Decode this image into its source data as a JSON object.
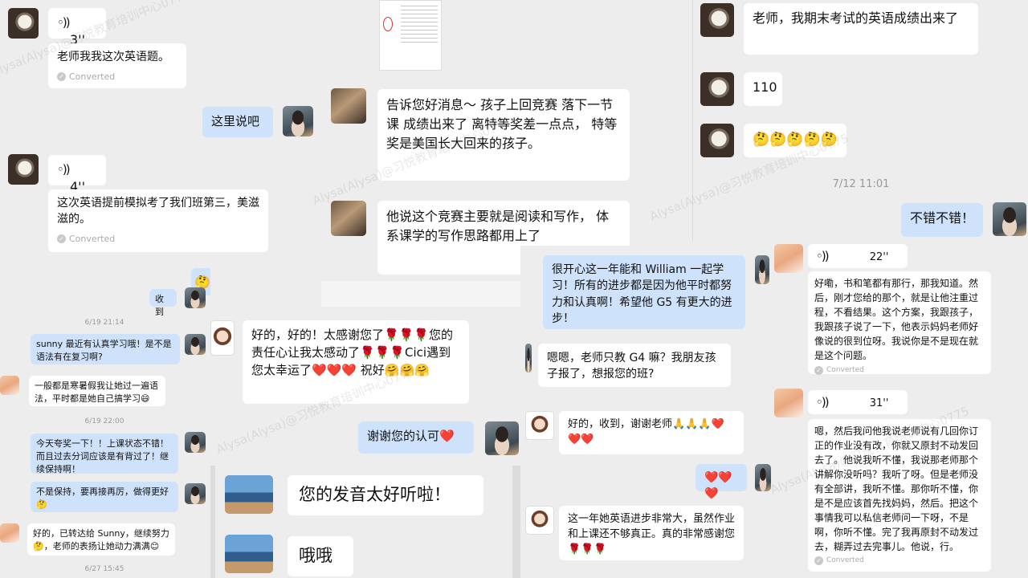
{
  "panel_left_top": {
    "voice1_duration": "3''",
    "msg1": "老师我我这次英语题。",
    "converted": "Converted",
    "reply1": "这里说吧",
    "voice2_duration": "4''",
    "msg2": "这次英语提前模拟考了我们班第三，美滋滋的。"
  },
  "panel_center_top": {
    "msg1": "告诉您好消息～ 孩子上回竞赛 落下一节课 成绩出来了 离特等奖差一点点， 特等奖是美国长大回来的孩子。",
    "msg2": "他说这个竞赛主要就是阅读和写作， 体系课学的写作思路都用上了"
  },
  "panel_right_top": {
    "msg1": "老师，我期末考试的英语成绩出来了",
    "msg2": "110",
    "msg3": "🤔🤔🤔🤔🤔",
    "time1": "7/12 11:01",
    "reply1": "不错不错！"
  },
  "panel_left_small": {
    "emoji_strip": "🤔🤔🤔🤔",
    "reply_received": "收到",
    "time1": "6/19 21:14",
    "msg1": "sunny 最近有认真学习哦！是不是语法有在复习啊?",
    "msg2": "一般都是寒暑假我让她过一遍语法，平时都是她自己搞学习😄",
    "time2": "6/19 22:00",
    "msg3": "今天夸奖一下！！上课状态不错！而且过去分词应该是有背过了！继续保持啊！",
    "msg4": "不是保持，要再接再厉，做得更好🤔",
    "msg5": "好的，已转达给 Sunny，继续努力🤔，老师的表扬让她动力满满😊",
    "time3": "6/27 15:45"
  },
  "panel_center_mid": {
    "msg1": "好的，好的！太感谢您了🌹🌹🌹您的责任心让我太感动了🌹🌹🌹Cici遇到您太幸运了❤️❤️❤️ 祝好🤗🤗🤗",
    "reply1": "谢谢您的认可❤️"
  },
  "panel_center_bottom": {
    "msg1": "您的发音太好听啦！",
    "msg2": "哦哦"
  },
  "panel_mid_right": {
    "msg1": "很开心这一年能和 William 一起学习！所有的进步都是因为他平时都努力和认真啊！希望他 G5 有更大的进步！",
    "msg2": "嗯嗯，老师只教 G4 嘛？我朋友孩子报了，想报您的班?",
    "msg3": "好的，收到，谢谢老师🙏🙏🙏❤️❤️❤️",
    "reply1": "❤️❤️❤️",
    "msg4": "这一年她英语进步非常大，虽然作业和上课还不够真正。真的非常感谢您🌹🌹🌹"
  },
  "panel_far_right": {
    "voice1_duration": "22''",
    "msg1": "好嘞，书和笔都有那行，那我知道。然后，刚才您给的那个，就是让他注重过程，不看结果。这个方案，我跟孩子，我跟孩子说了一下，他表示妈妈老师好像说的很到位呀。我说你是不是现在就是这个问题。",
    "converted": "Converted",
    "voice2_duration": "31''",
    "msg2": "嗯，然后我问他我说老师说有几回你订正的作业没有改，你就又原封不动发回去了。他说我听不懂，我说那老师那个讲解你没听吗？我听了呀。但是老师没有全部讲，我听不懂。那你听不懂，你是不是应该首先找妈妈，然后。把这个事情我可以私信老师问一下呀，不是啊，你听不懂。完了我再原封不动发过去，糊弄过去完事儿。他说，行。"
  },
  "watermark": "Alysa(Alysa)@习悦教育培训中心0775",
  "colors": {
    "page_bg": "#ededed",
    "bubble_white": "#ffffff",
    "bubble_blue": "#cfe2fb",
    "meta_grey": "#999999"
  }
}
